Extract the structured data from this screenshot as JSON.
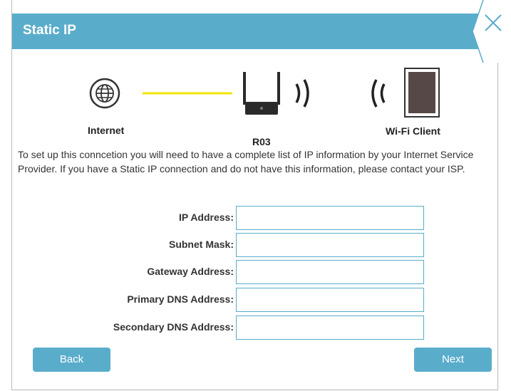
{
  "dialog": {
    "title": "Static IP",
    "accent_color": "#5aaccb"
  },
  "diagram": {
    "internet_label": "Internet",
    "router_label": "R03",
    "client_label": "Wi-Fi Client",
    "internet_icon": "globe-icon",
    "router_icon": "router-icon",
    "client_icon": "tablet-icon",
    "link_color": "#f2e600"
  },
  "description": "To set up this conncetion you will need to have a complete list of IP information by your Internet Service Provider. If you have a Static IP connection and do not have this information, please contact your ISP.",
  "form": {
    "fields": [
      {
        "label": "IP Address:",
        "value": ""
      },
      {
        "label": "Subnet Mask:",
        "value": ""
      },
      {
        "label": "Gateway Address:",
        "value": ""
      },
      {
        "label": "Primary DNS Address:",
        "value": ""
      },
      {
        "label": "Secondary DNS Address:",
        "value": ""
      }
    ]
  },
  "buttons": {
    "back_label": "Back",
    "next_label": "Next"
  }
}
